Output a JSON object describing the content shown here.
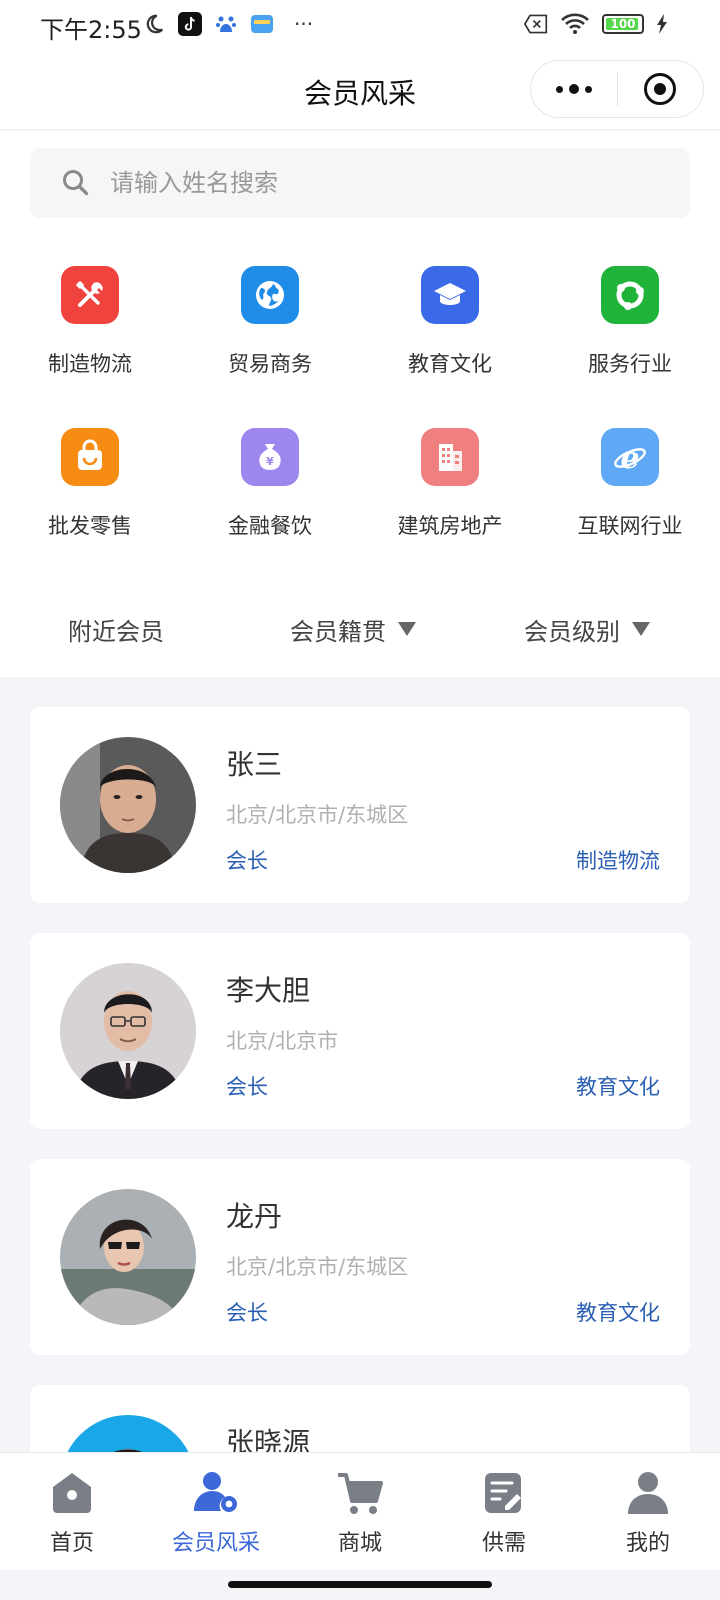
{
  "status_bar": {
    "time": "下午2:55",
    "more": "···",
    "battery": "100"
  },
  "navbar": {
    "title": "会员风采"
  },
  "search": {
    "placeholder": "请输入姓名搜索",
    "value": ""
  },
  "categories": [
    {
      "label": "制造物流",
      "icon": "wrench-screwdriver-icon",
      "color": "#f0433d"
    },
    {
      "label": "贸易商务",
      "icon": "globe-icon",
      "color": "#1f8ce8"
    },
    {
      "label": "教育文化",
      "icon": "graduation-cap-icon",
      "color": "#3b6ae8"
    },
    {
      "label": "服务行业",
      "icon": "service-ring-icon",
      "color": "#20b33a"
    },
    {
      "label": "批发零售",
      "icon": "shopping-bag-icon",
      "color": "#f78c12"
    },
    {
      "label": "金融餐饮",
      "icon": "money-bag-icon",
      "color": "#9d86ee"
    },
    {
      "label": "建筑房地产",
      "icon": "building-icon",
      "color": "#f07f7f"
    },
    {
      "label": "互联网行业",
      "icon": "ie-browser-icon",
      "color": "#5fa8f5"
    }
  ],
  "filters": {
    "nearby": "附近会员",
    "origin": "会员籍贯",
    "level": "会员级别"
  },
  "members": [
    {
      "name": "张三",
      "location": "北京/北京市/东城区",
      "role": "会长",
      "industry": "制造物流"
    },
    {
      "name": "李大胆",
      "location": "北京/北京市",
      "role": "会长",
      "industry": "教育文化"
    },
    {
      "name": "龙丹",
      "location": "北京/北京市/东城区",
      "role": "会长",
      "industry": "教育文化"
    },
    {
      "name": "张晓源",
      "location": "",
      "role": "",
      "industry": ""
    }
  ],
  "tabbar": [
    {
      "label": "首页",
      "icon": "home-icon",
      "active": false
    },
    {
      "label": "会员风采",
      "icon": "member-icon",
      "active": true
    },
    {
      "label": "商城",
      "icon": "cart-icon",
      "active": false
    },
    {
      "label": "供需",
      "icon": "note-edit-icon",
      "active": false
    },
    {
      "label": "我的",
      "icon": "user-icon",
      "active": false
    }
  ],
  "colors": {
    "accent": "#3d68d8",
    "link": "#2b5fb4",
    "icon_gray": "#7a7f87"
  }
}
